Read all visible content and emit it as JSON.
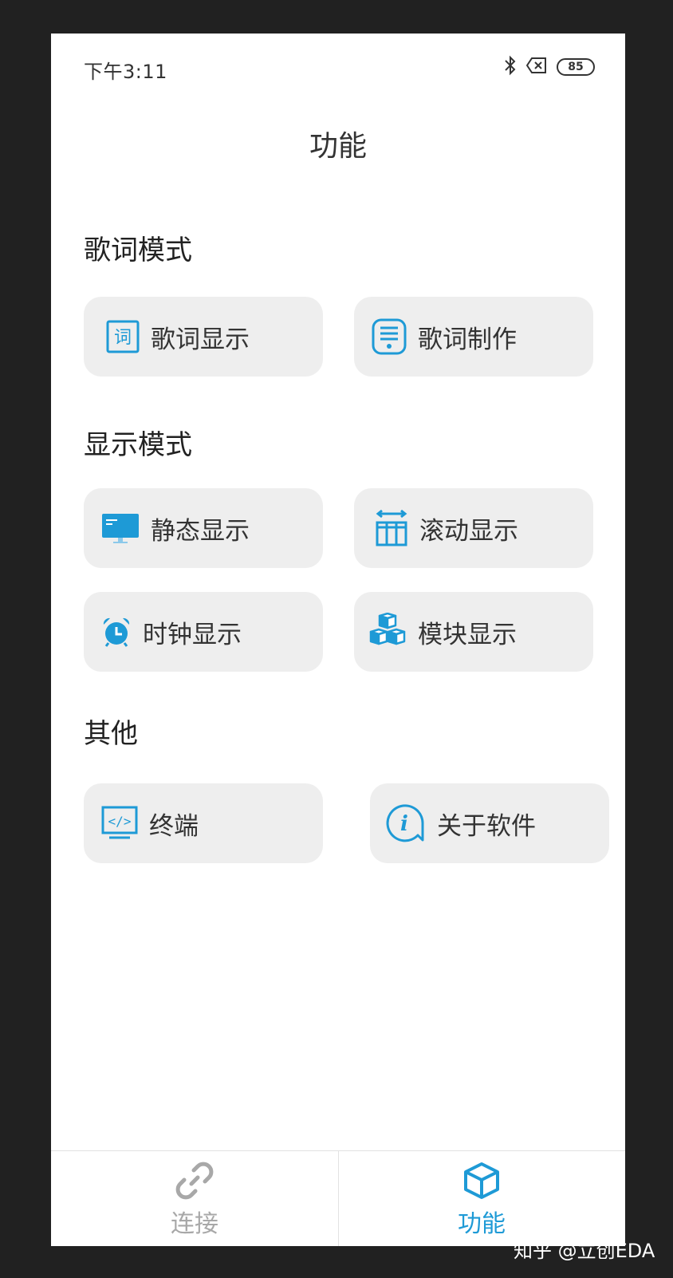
{
  "status_bar": {
    "time": "下午3:11",
    "battery": "85",
    "icons": [
      "bluetooth-icon",
      "no-sim-icon",
      "battery-icon"
    ]
  },
  "header": {
    "title": "功能"
  },
  "sections": [
    {
      "title": "歌词模式",
      "items": [
        {
          "label": "歌词显示",
          "icon": "lyrics-display-icon",
          "icon_text": "词"
        },
        {
          "label": "歌词制作",
          "icon": "lyrics-edit-icon"
        }
      ]
    },
    {
      "title": "显示模式",
      "items": [
        {
          "label": "静态显示",
          "icon": "monitor-icon"
        },
        {
          "label": "滚动显示",
          "icon": "scroll-icon"
        },
        {
          "label": "时钟显示",
          "icon": "alarm-clock-icon"
        },
        {
          "label": "模块显示",
          "icon": "cubes-icon"
        }
      ]
    },
    {
      "title": "其他",
      "items": [
        {
          "label": "终端",
          "icon": "terminal-code-icon",
          "icon_text": "</>"
        },
        {
          "label": "关于软件",
          "icon": "info-bubble-icon",
          "icon_text": "i"
        }
      ]
    }
  ],
  "tabbar": {
    "tabs": [
      {
        "label": "连接",
        "icon": "link-icon",
        "active": false
      },
      {
        "label": "功能",
        "icon": "box-icon",
        "active": true
      }
    ]
  },
  "colors": {
    "accent": "#1e9ad6",
    "card_bg": "#eeeeee",
    "inactive_tab": "#a8a8a8",
    "frame": "#212121"
  },
  "watermark": "知乎 @立创EDA"
}
